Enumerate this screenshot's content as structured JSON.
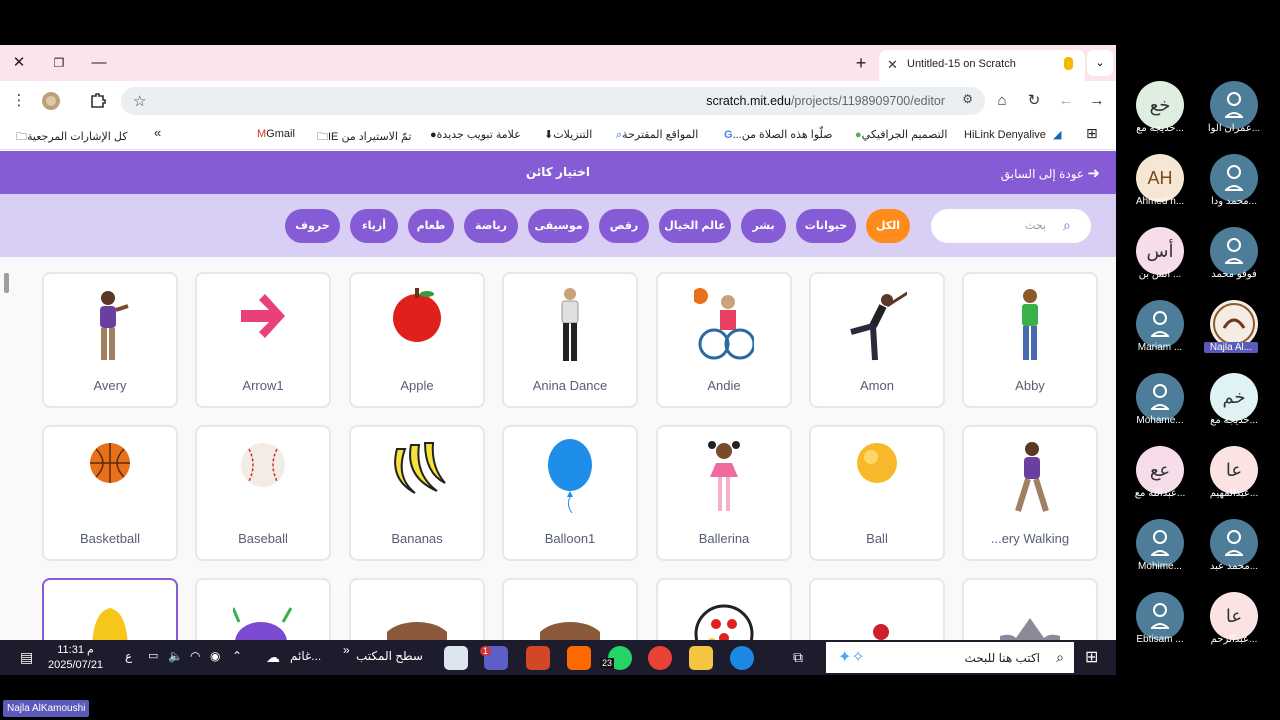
{
  "browser": {
    "tab_title": "Untitled-15 on Scratch",
    "url_host": "scratch.mit.edu",
    "url_path": "/projects/1198909700/editor",
    "bookmarks": [
      "HiLink Denyalive",
      "التصميم الجرافيكي",
      "صلّوا هذه الصلاة من...",
      "المواقع المقترحة",
      "التنزيلات",
      "علامة تبويب جديدة",
      "تمّ الاستيراد من IE",
      "Gmail"
    ],
    "bookmarks_more": "»",
    "bookmarks_folder": "كل الإشارات المرجعية"
  },
  "scratch": {
    "header_title": "اختيار كائن",
    "back_label": "عودة إلى السابق",
    "search_placeholder": "بحث",
    "filters": [
      "الكل",
      "حيوانات",
      "بشر",
      "عالم الخيال",
      "رقص",
      "موسيقى",
      "رياضة",
      "طعام",
      "أزياء",
      "حروف"
    ],
    "sprites_row1": [
      "Avery",
      "Arrow1",
      "Apple",
      "Anina Dance",
      "Andie",
      "Amon",
      "Abby"
    ],
    "sprites_row2": [
      "Basketball",
      "Baseball",
      "Bananas",
      "Balloon1",
      "Ballerina",
      "Ball",
      "...ery Walking"
    ]
  },
  "taskbar": {
    "search_text": "اكتب هنا للبحث",
    "time": "11:31 م",
    "date": "2025/07/21",
    "lang": "ع",
    "desktop": "سطح المكتب",
    "weather": "غائم...",
    "chevron": "»",
    "whatsapp_badge": "23",
    "teams_badge": "1"
  },
  "participants": [
    {
      "initials": "",
      "name": "عمران الوا...",
      "avatar": "person-icon"
    },
    {
      "initials": "خع",
      "name": "خديجة مع...",
      "color": "#dfeee0",
      "text": "#333"
    },
    {
      "initials": "",
      "name": "محمد ودا...",
      "avatar": "person-icon"
    },
    {
      "initials": "AH",
      "name": "Ahmed h...",
      "color": "#f5e7d3",
      "text": "#7a4b1a"
    },
    {
      "initials": "",
      "name": "فوفو محمد",
      "avatar": "person-icon"
    },
    {
      "initials": "أس",
      "name": "أنس بن ...",
      "color": "#f6dde9",
      "text": "#333"
    },
    {
      "initials": "",
      "name": "Najla Al...",
      "avatar": "logo",
      "highlight": true
    },
    {
      "initials": "",
      "name": "Mariam ...",
      "avatar": "person-icon"
    },
    {
      "initials": "خم",
      "name": "خديجة مع...",
      "color": "#dff3f5",
      "text": "#333"
    },
    {
      "initials": "",
      "name": "Mohame...",
      "avatar": "person-icon"
    },
    {
      "initials": "عا",
      "name": "عبدالمهيم...",
      "color": "#fbe3e3",
      "text": "#333"
    },
    {
      "initials": "عع",
      "name": "عبدالله مع...",
      "color": "#f6dde9",
      "text": "#333"
    },
    {
      "initials": "",
      "name": "محمد عبد...",
      "avatar": "person-icon"
    },
    {
      "initials": "",
      "name": "Mohime...",
      "avatar": "person-icon"
    },
    {
      "initials": "عا",
      "name": "عبدالرحم...",
      "color": "#fbe3e3",
      "text": "#333"
    },
    {
      "initials": "",
      "name": "Ebtisam ...",
      "avatar": "person-icon"
    }
  ],
  "presenter_name": "Najla AlKamoushi",
  "colors": {
    "scratch_purple": "#855cd6",
    "active_filter": "#ff8c1a",
    "filter_bg": "#d9cff5"
  }
}
